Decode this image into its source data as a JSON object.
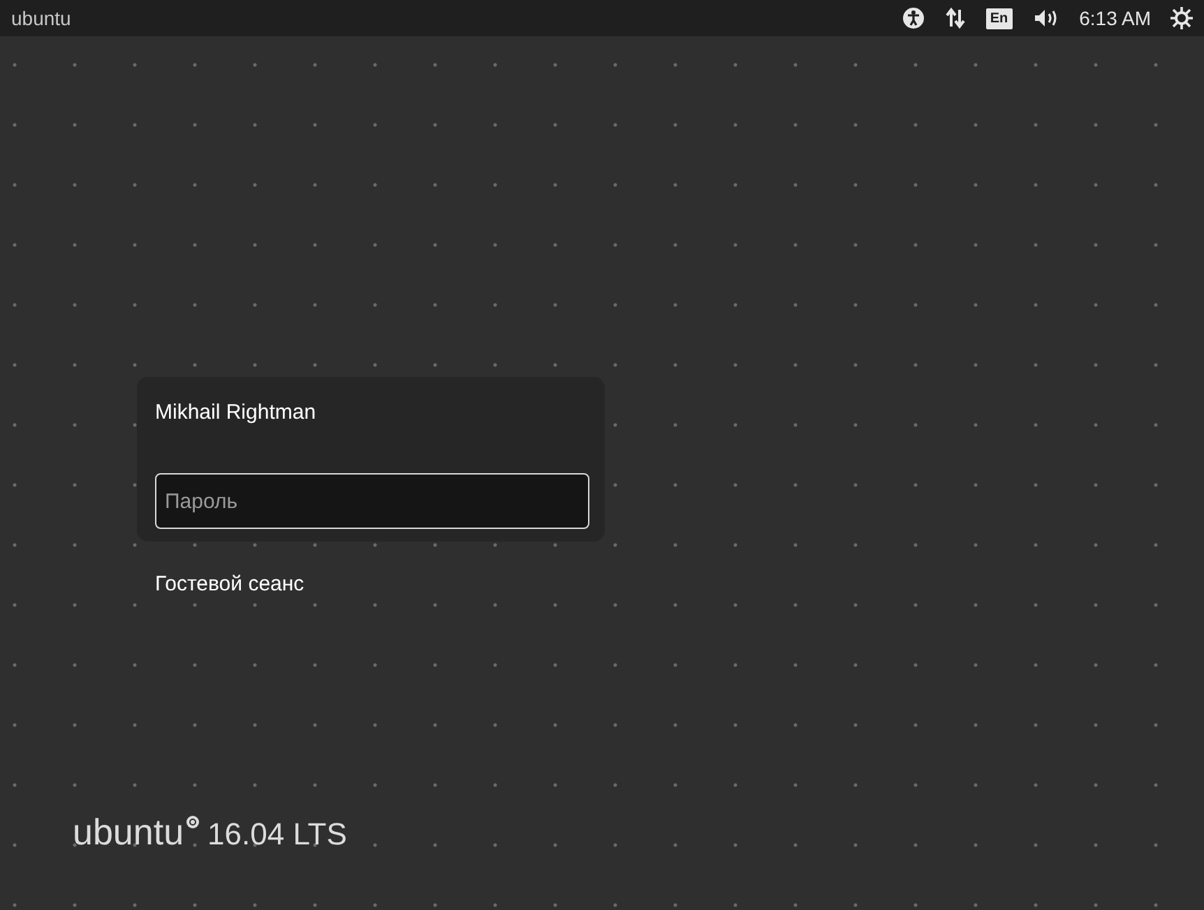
{
  "top_bar": {
    "title": "ubuntu",
    "keyboard_layout": "En",
    "clock": "6:13 AM"
  },
  "login": {
    "user_name": "Mikhail Rightman",
    "password_field": {
      "placeholder": "Пароль"
    },
    "guest_session": "Гостевой сеанс"
  },
  "branding": {
    "name": "ubuntu",
    "version": "16.04 LTS"
  }
}
